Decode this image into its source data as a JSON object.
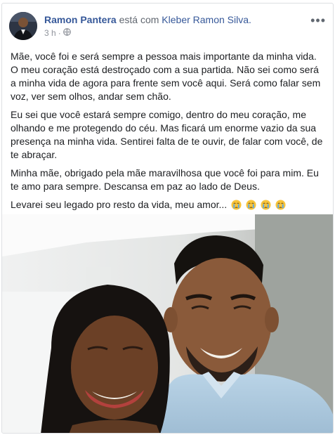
{
  "post": {
    "author": "Ramon Pantera",
    "with_text": "está com",
    "tagged": "Kleber Ramon Silva.",
    "time": "3 h",
    "separator": "·",
    "privacy_icon": "globe-icon",
    "more_icon": "more-options-icon",
    "more_glyph": "•••",
    "paragraphs": [
      "Mãe, você foi e será sempre a pessoa mais importante da minha vida. O meu coração está destroçado com a sua partida. Não sei como será a minha vida de agora para frente sem você aqui. Será como falar sem voz, ver sem olhos, andar sem chão.",
      "Eu sei que você estará sempre comigo, dentro do meu coração, me olhando e me protegendo do céu. Mas ficará um enorme vazio da sua presença na minha vida. Sentirei falta de te ouvir, de falar com você, de te abraçar.",
      "Minha mãe, obrigado pela mãe maravilhosa que você foi para mim. Eu te amo para sempre. Descansa em paz ao lado de Deus."
    ],
    "last_line": "Levarei seu legado pro resto da vida, meu amor...",
    "emojis": [
      "crying-face-emoji",
      "crying-face-emoji",
      "crying-face-emoji",
      "crying-face-emoji"
    ]
  }
}
